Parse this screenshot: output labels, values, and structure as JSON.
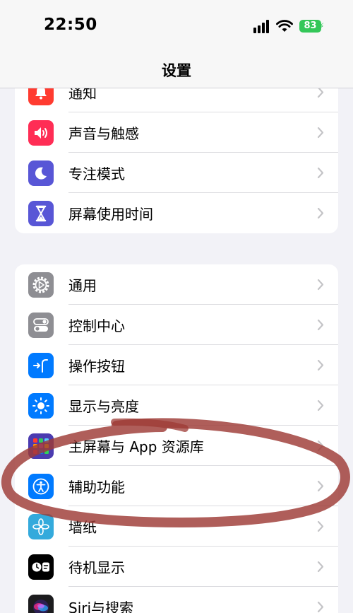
{
  "status_bar": {
    "time": "22:50",
    "battery": "83",
    "icons": [
      "cellular-signal-icon",
      "wifi-icon",
      "battery-charging-icon"
    ]
  },
  "nav": {
    "title": "设置"
  },
  "groups": [
    {
      "items": [
        {
          "label": "通知",
          "icon": "bell-icon",
          "color": "#ff3b30"
        },
        {
          "label": "声音与触感",
          "icon": "speaker-icon",
          "color": "#ff2d55"
        },
        {
          "label": "专注模式",
          "icon": "moon-icon",
          "color": "#5856d6"
        },
        {
          "label": "屏幕使用时间",
          "icon": "hourglass-icon",
          "color": "#5856d6"
        }
      ]
    },
    {
      "items": [
        {
          "label": "通用",
          "icon": "gear-icon",
          "color": "#8e8e93"
        },
        {
          "label": "控制中心",
          "icon": "toggles-icon",
          "color": "#8e8e93"
        },
        {
          "label": "操作按钮",
          "icon": "action-button-icon",
          "color": "#007aff"
        },
        {
          "label": "显示与亮度",
          "icon": "sun-icon",
          "color": "#007aff"
        },
        {
          "label": "主屏幕与 App 资源库",
          "icon": "app-grid-icon",
          "color": "#4b3bb0"
        },
        {
          "label": "辅助功能",
          "icon": "accessibility-icon",
          "color": "#007aff"
        },
        {
          "label": "墙纸",
          "icon": "flower-icon",
          "color": "#34aadc"
        },
        {
          "label": "待机显示",
          "icon": "standby-icon",
          "color": "#000000"
        },
        {
          "label": "Siri与搜索",
          "icon": "siri-icon",
          "color": "#1c1c1e"
        }
      ]
    }
  ],
  "annotation": {
    "circled_item": "辅助功能",
    "stroke_color": "#9e3b36"
  }
}
